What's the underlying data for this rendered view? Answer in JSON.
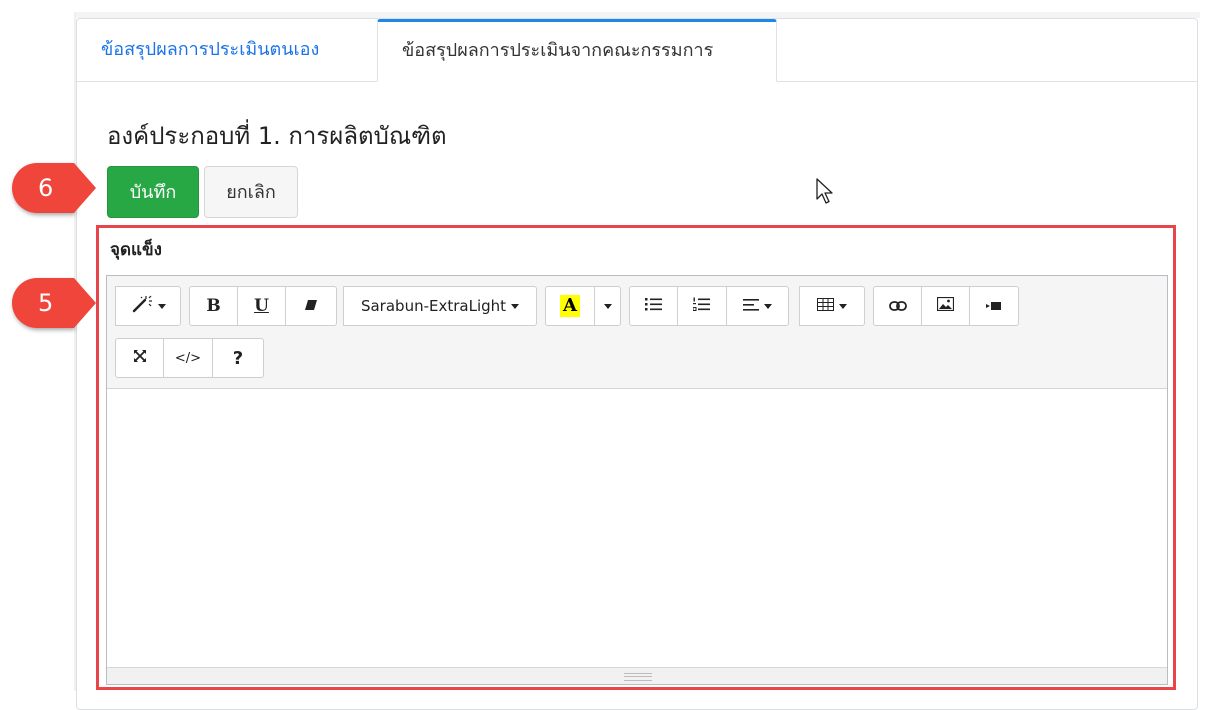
{
  "tabs": [
    {
      "label": "ข้อสรุปผลการประเมินตนเอง"
    },
    {
      "label": "ข้อสรุปผลการประเมินจากคณะกรรมการ"
    }
  ],
  "section": {
    "title": "องค์ประกอบที่ 1. การผลิตบัณฑิต"
  },
  "buttons": {
    "save": "บันทึก",
    "cancel": "ยกเลิก"
  },
  "callouts": {
    "save_step": "6",
    "editor_step": "5"
  },
  "field": {
    "label": "จุดแข็ง",
    "value": ""
  },
  "toolbar": {
    "font_name": "Sarabun-ExtraLight",
    "bold": "B",
    "underline": "U",
    "fore_color_glyph": "A",
    "codeview": "</>",
    "help": "?",
    "icons": [
      "magic-icon",
      "bold-icon",
      "underline-icon",
      "eraser-icon",
      "font-color-icon",
      "unordered-list-icon",
      "ordered-list-icon",
      "align-icon",
      "table-icon",
      "link-icon",
      "picture-icon",
      "video-icon",
      "fullscreen-icon",
      "code-view-icon",
      "help-icon"
    ]
  },
  "colors": {
    "save_bg": "#28a745",
    "tab_active_border": "#1e88e5",
    "tab_link": "#1a73e8",
    "highlight": "#e8454a",
    "callout": "#f0453a",
    "font_color": "#ffff00"
  }
}
